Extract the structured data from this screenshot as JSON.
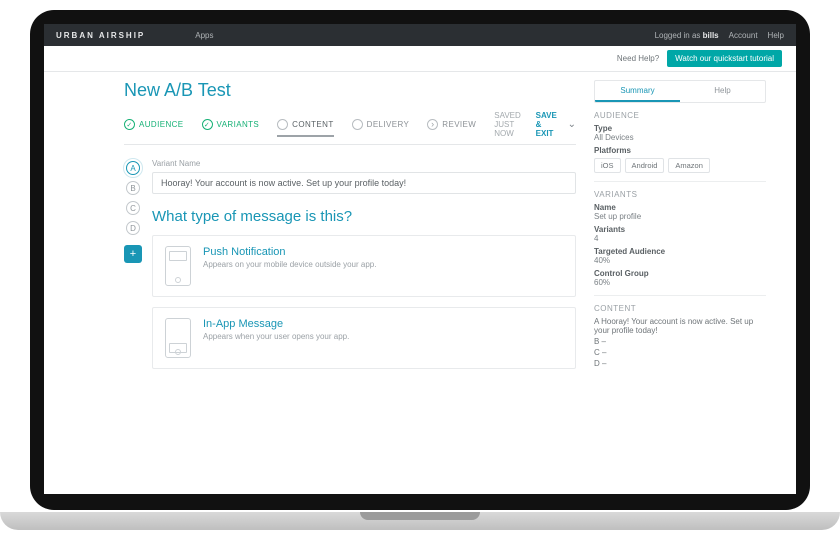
{
  "topbar": {
    "brand": "URBAN AIRSHIP",
    "apps": "Apps",
    "logged_in_prefix": "Logged in as ",
    "user": "bills",
    "account": "Account",
    "help": "Help"
  },
  "subbar": {
    "need_help": "Need Help?",
    "tutorial_btn": "Watch our quickstart tutorial"
  },
  "page": {
    "title": "New A/B Test"
  },
  "steps": {
    "audience": "AUDIENCE",
    "variants": "VARIANTS",
    "content": "CONTENT",
    "delivery": "DELIVERY",
    "review": "REVIEW",
    "saved": "SAVED JUST NOW",
    "save_exit": "SAVE & EXIT"
  },
  "editor": {
    "var_a": "A",
    "var_b": "B",
    "var_c": "C",
    "var_d": "D",
    "field_label": "Variant Name",
    "variant_name": "Hooray! Your account is now active. Set up your profile today!",
    "question": "What type of message is this?",
    "push_title": "Push Notification",
    "push_desc": "Appears on your mobile device outside your app.",
    "inapp_title": "In-App Message",
    "inapp_desc": "Appears when your user opens your app."
  },
  "side": {
    "tab_summary": "Summary",
    "tab_help": "Help",
    "sec_audience": "AUDIENCE",
    "type_k": "Type",
    "type_v": "All Devices",
    "platforms_k": "Platforms",
    "chip_ios": "iOS",
    "chip_android": "Android",
    "chip_amazon": "Amazon",
    "sec_variants": "VARIANTS",
    "name_k": "Name",
    "name_v": "Set up profile",
    "variants_k": "Variants",
    "variants_v": "4",
    "targeted_k": "Targeted Audience",
    "targeted_v": "40%",
    "control_k": "Control Group",
    "control_v": "60%",
    "sec_content": "CONTENT",
    "content_a": "A   Hooray! Your account is now active. Set up your profile today!",
    "content_b": "B   –",
    "content_c": "C   –",
    "content_d": "D   –"
  }
}
